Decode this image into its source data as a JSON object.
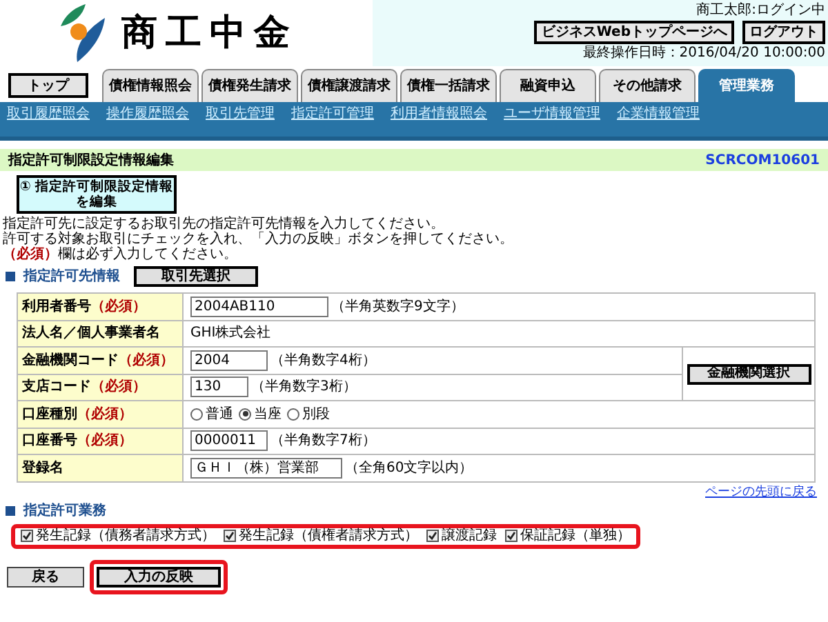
{
  "header": {
    "logo_text": "商工中金",
    "user_status": "商工太郎:ログイン中",
    "buttons": [
      "ビジネスWebトップページへ",
      "ログアウト"
    ],
    "last_operation": "最終操作日時：2016/04/20 10:00:00"
  },
  "top_button": "トップ",
  "tabs": [
    {
      "label": "債権情報照会",
      "selected": false
    },
    {
      "label": "債権発生請求",
      "selected": false
    },
    {
      "label": "債権譲渡請求",
      "selected": false
    },
    {
      "label": "債権一括請求",
      "selected": false
    },
    {
      "label": "融資申込",
      "selected": false
    },
    {
      "label": "その他請求",
      "selected": false
    },
    {
      "label": "管理業務",
      "selected": true
    }
  ],
  "subnav": [
    "取引履歴照会",
    "操作履歴照会",
    "取引先管理",
    "指定許可管理",
    "利用者情報照会",
    "ユーザ情報管理",
    "企業情報管理"
  ],
  "page_title": "指定許可制限設定情報編集",
  "screen_id": "SCRCOM10601",
  "step": {
    "number": "①",
    "label_lines": [
      "指定許可制限設定情報",
      "を編集"
    ]
  },
  "instructions": [
    "指定許可先に設定するお取引先の指定許可先情報を入力してください。",
    "許可する対象お取引にチェックを入れ、「入力の反映」ボタンを押してください。"
  ],
  "required_note": {
    "mark": "（必須）",
    "text": "欄は必ず入力してください。"
  },
  "section1": {
    "title": "指定許可先情報",
    "button": "取引先選択"
  },
  "form": {
    "side_button": "金融機関選択",
    "rows": [
      {
        "kind": "input",
        "label": "利用者番号",
        "required": "（必須）",
        "value": "2004AB110",
        "hint": "（半角英数字9文字）"
      },
      {
        "kind": "text",
        "label": "法人名／個人事業者名",
        "value": "GHI株式会社"
      },
      {
        "kind": "input",
        "label": "金融機関コード",
        "required": "（必須）",
        "value": "2004",
        "hint": "（半角数字4桁）"
      },
      {
        "kind": "input",
        "label": "支店コード",
        "required": "（必須）",
        "value": "130",
        "hint": "（半角数字3桁）"
      },
      {
        "kind": "radio",
        "label": "口座種別",
        "required": "（必須）",
        "options": [
          {
            "label": "普通",
            "selected": false
          },
          {
            "label": "当座",
            "selected": true
          },
          {
            "label": "別段",
            "selected": false
          }
        ]
      },
      {
        "kind": "input",
        "label": "口座番号",
        "required": "（必須）",
        "value": "0000011",
        "hint": "（半角数字7桁）"
      },
      {
        "kind": "input",
        "label": "登録名",
        "value": "ＧＨＩ（株）営業部",
        "hint": "（全角60文字以内）"
      }
    ]
  },
  "back_to_top": "ページの先頭に戻る",
  "section2": {
    "title": "指定許可業務",
    "highlighted": true,
    "checkboxes": [
      {
        "label": "発生記録（債務者請求方式）",
        "checked": true
      },
      {
        "label": "発生記録（債権者請求方式）",
        "checked": true
      },
      {
        "label": "譲渡記録",
        "checked": true
      },
      {
        "label": "保証記録（単独）",
        "checked": true
      }
    ]
  },
  "buttons": [
    {
      "label": "戻る",
      "highlighted": false
    },
    {
      "label": "入力の反映",
      "highlighted": true
    }
  ]
}
